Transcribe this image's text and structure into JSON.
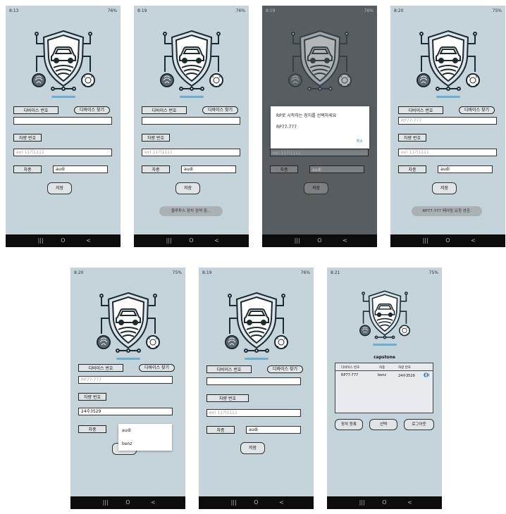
{
  "screens": [
    {
      "time": "8:13",
      "battery": "76%",
      "device_id": "",
      "car_number": "",
      "car_type": "audi"
    },
    {
      "time": "8:19",
      "battery": "76%",
      "device_id": "",
      "car_number": "",
      "car_type": "audi",
      "toast": "블루투스 장치 검색 중..."
    },
    {
      "time": "8:19",
      "battery": "76%",
      "car_type": "audi",
      "dialog": {
        "title": "RP로 시작하는 장치를 선택하세요",
        "item": "RP77-777",
        "cancel": "취소"
      }
    },
    {
      "time": "8:20",
      "battery": "75%",
      "device_id": "RP77-777",
      "car_number": "",
      "car_type": "audi",
      "toast": "RP77-777 페어링 요청 성공."
    },
    {
      "time": "8:20",
      "battery": "75%",
      "device_id": "RP77-777",
      "car_number": "24수3529",
      "dropdown": [
        "audi",
        "benz"
      ]
    },
    {
      "time": "8:19",
      "battery": "76%",
      "device_id": "",
      "car_number": "",
      "car_type": "audi"
    },
    {
      "time": "8:21",
      "battery": "75%",
      "app_name": "capstone",
      "table": {
        "headers": [
          "디바이스 번호",
          "차종",
          "차량 번호"
        ],
        "row": [
          "RP77-777",
          "benz",
          "24수3529"
        ]
      },
      "buttons": {
        "register": "장치 등록",
        "select": "선택",
        "logout": "로그아웃"
      }
    }
  ],
  "form": {
    "device_label": "디바이스 번호",
    "find_button": "디바이스 찾기",
    "car_number_label": "차량 번호",
    "car_number_placeholder": "ex) 11가1111",
    "car_type_label": "차종",
    "save_button": "저장"
  },
  "nav": {
    "recent": "|||",
    "home": "O",
    "back": "<"
  },
  "icons": {
    "logo": "shield-car-logo-icon",
    "fingerprint": "fingerprint-icon",
    "face": "face-id-icon",
    "bluetooth": "bluetooth-icon"
  },
  "colors": {
    "screen_bg": "#c5d3da",
    "dim_bg": "#575d61",
    "accent": "#6aaed0",
    "navbar": "#0c0c0c"
  }
}
